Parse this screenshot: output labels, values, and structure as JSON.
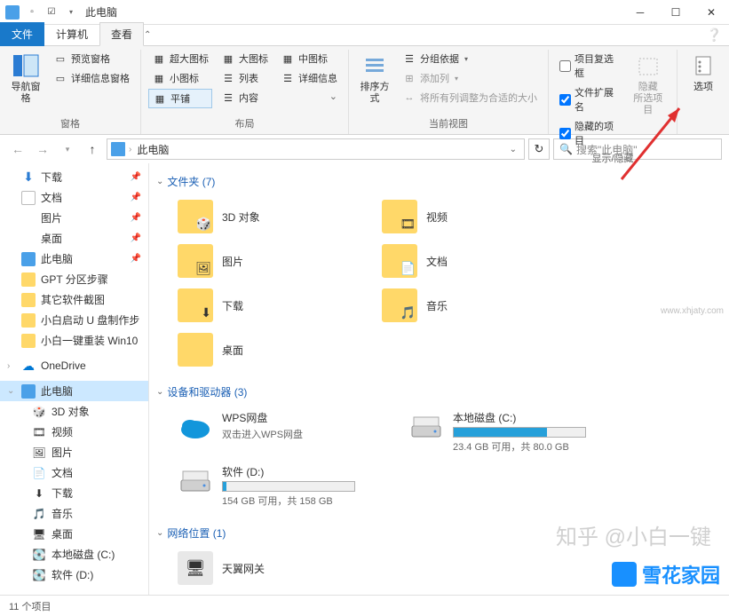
{
  "title": "此电脑",
  "tabs": {
    "file": "文件",
    "computer": "计算机",
    "view": "查看"
  },
  "ribbon": {
    "panes": {
      "nav_pane": "导航窗格",
      "preview_pane": "预览窗格",
      "details_pane": "详细信息窗格",
      "group_label": "窗格"
    },
    "layout": {
      "extra_large": "超大图标",
      "large": "大图标",
      "medium": "中图标",
      "small": "小图标",
      "list": "列表",
      "details": "详细信息",
      "tiles": "平铺",
      "content": "内容",
      "group_label": "布局"
    },
    "current_view": {
      "sort_by": "排序方式",
      "group_by": "分组依据",
      "add_columns": "添加列",
      "size_all": "将所有列调整为合适的大小",
      "group_label": "当前视图"
    },
    "show_hide": {
      "item_check": "项目复选框",
      "file_ext": "文件扩展名",
      "hidden_items": "隐藏的项目",
      "hide_selected_top": "隐藏",
      "hide_selected_bottom": "所选项目",
      "group_label": "显示/隐藏"
    },
    "options": "选项"
  },
  "address": {
    "location": "此电脑",
    "search_placeholder": "搜索\"此电脑\""
  },
  "sidebar": {
    "items": [
      {
        "label": "下载",
        "pin": true,
        "icon": "download"
      },
      {
        "label": "文档",
        "pin": true,
        "icon": "doc"
      },
      {
        "label": "图片",
        "pin": true,
        "icon": "pic"
      },
      {
        "label": "桌面",
        "pin": true,
        "icon": "desktop"
      },
      {
        "label": "此电脑",
        "pin": true,
        "icon": "pc"
      },
      {
        "label": "GPT 分区步骤",
        "pin": false,
        "icon": "folder"
      },
      {
        "label": "其它软件截图",
        "pin": false,
        "icon": "folder"
      },
      {
        "label": "小白启动 U 盘制作步",
        "pin": false,
        "icon": "folder"
      },
      {
        "label": "小白一键重装 Win10",
        "pin": false,
        "icon": "folder"
      }
    ],
    "onedrive": "OneDrive",
    "this_pc": "此电脑",
    "pc_children": [
      {
        "label": "3D 对象",
        "icon": "3d"
      },
      {
        "label": "视频",
        "icon": "video"
      },
      {
        "label": "图片",
        "icon": "pic"
      },
      {
        "label": "文档",
        "icon": "doc"
      },
      {
        "label": "下载",
        "icon": "download"
      },
      {
        "label": "音乐",
        "icon": "music"
      },
      {
        "label": "桌面",
        "icon": "desktop"
      },
      {
        "label": "本地磁盘 (C:)",
        "icon": "drive"
      },
      {
        "label": "软件 (D:)",
        "icon": "drive"
      }
    ]
  },
  "content": {
    "folders_header": "文件夹 (7)",
    "folders": [
      {
        "label": "3D 对象"
      },
      {
        "label": "视频"
      },
      {
        "label": "图片"
      },
      {
        "label": "文档"
      },
      {
        "label": "下载"
      },
      {
        "label": "音乐"
      },
      {
        "label": "桌面"
      }
    ],
    "drives_header": "设备和驱动器 (3)",
    "drives": [
      {
        "name": "WPS网盘",
        "sub": "双击进入WPS网盘",
        "type": "cloud"
      },
      {
        "name": "本地磁盘 (C:)",
        "sub": "23.4 GB 可用，共 80.0 GB",
        "fill": 71,
        "type": "drive"
      },
      {
        "name": "软件 (D:)",
        "sub": "154 GB 可用，共 158 GB",
        "fill": 3,
        "type": "drive"
      }
    ],
    "network_header": "网络位置 (1)",
    "network": [
      {
        "label": "天翼网关"
      }
    ]
  },
  "status": {
    "items": "11 个项目"
  },
  "watermarks": {
    "zh": "知乎 @小白一键",
    "logo": "雪花家园",
    "url": "www.xhjaty.com"
  }
}
